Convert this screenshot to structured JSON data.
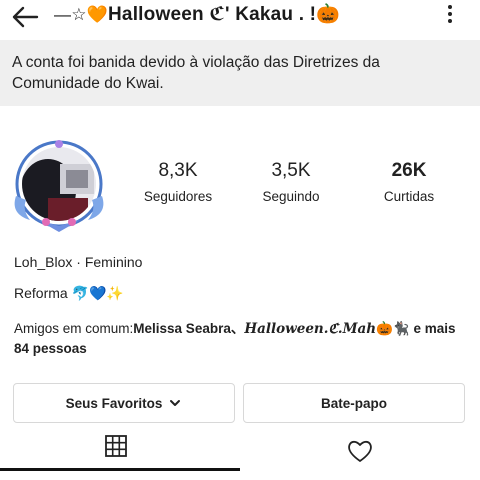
{
  "header": {
    "title_prefix": "—☆🧡",
    "title": "Halloween ℭ' Kakau .",
    "title_suffix": " !🎃"
  },
  "banner": {
    "text": "A conta foi banida devido à violação das Diretrizes da Comunidade do Kwai."
  },
  "stats": [
    {
      "value": "8,3K",
      "label": "Seguidores"
    },
    {
      "value": "3,5K",
      "label": "Seguindo"
    },
    {
      "value": "26K",
      "label": "Curtidas"
    }
  ],
  "profile": {
    "username": "Loh_Blox",
    "separator": "·",
    "gender": "Feminino",
    "bio": "Reforma 🐬💙✨",
    "mutual_prefix": "Amigos em comum:",
    "mutual_names": "Melissa Seabra、",
    "mutual_fancy": "Halloween.ℭ.Mah",
    "mutual_emoji": "🎃🐈‍⬛",
    "mutual_suffix": " e mais 84 pessoas"
  },
  "buttons": {
    "favorites": "Seus Favoritos",
    "chat": "Bate-papo"
  },
  "icons": {
    "back": "arrow-left-icon",
    "more": "kebab-menu-icon",
    "grid": "grid-icon",
    "heart": "heart-icon",
    "chevron": "chevron-down-icon"
  },
  "colors": {
    "banner_bg": "#efefef",
    "avatar_ring": "#4a78c8"
  }
}
